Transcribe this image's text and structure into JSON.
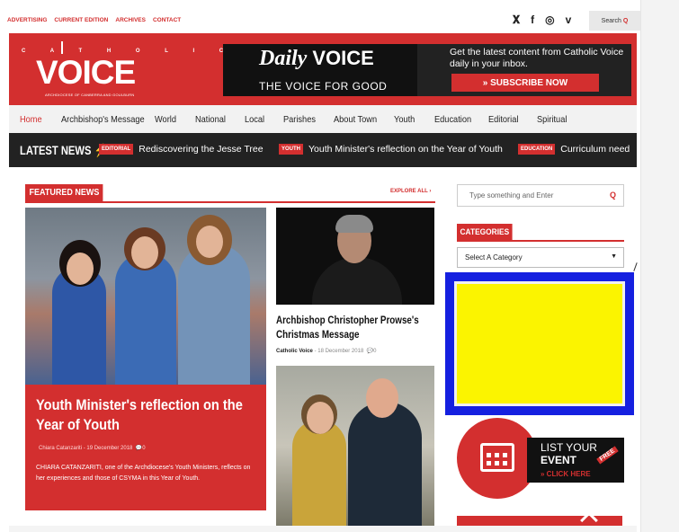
{
  "toplinks": [
    "ADVERTISING",
    "CURRENT EDITION",
    "ARCHIVES",
    "CONTACT"
  ],
  "social_icons": [
    "twitter-icon",
    "facebook-icon",
    "instagram-icon",
    "vimeo-icon"
  ],
  "top_search": {
    "label": "Search",
    "icon": "Q"
  },
  "logo": {
    "top_letters": "C A T H O L I C",
    "main": "VOICE",
    "sub": "ARCHDIOCESE OF CANBERRA AND GOULBURN"
  },
  "daily_banner": {
    "brand": "Daily",
    "brand2": "VOICE",
    "tagline": "THE VOICE FOR GOOD"
  },
  "promo": {
    "text": "Get the latest content from Catholic Voice daily in your inbox.",
    "button": "» SUBSCRIBE NOW"
  },
  "nav": [
    "Home",
    "Archbishop's Message",
    "World",
    "National",
    "Local",
    "Parishes",
    "About Town",
    "Youth",
    "Education",
    "Editorial",
    "Spiritual"
  ],
  "ticker": {
    "label": "LATEST NEWS",
    "items": [
      {
        "badge": "EDITORIAL",
        "text": "Rediscovering the Jesse Tree"
      },
      {
        "badge": "YOUTH",
        "text": "Youth Minister's reflection on the Year of Youth"
      },
      {
        "badge": "EDUCATION",
        "text": "Curriculum need"
      }
    ]
  },
  "featured": {
    "title": "FEATURED NEWS",
    "explore": "EXPLORE ALL",
    "main": {
      "headline": "Youth Minister's reflection on the Year of Youth",
      "meta": "Chiara Catanzariti - 19 December 2018",
      "comments": "0",
      "excerpt": "CHIARA CATANZARITI, one of the Archdiocese's Youth Ministers, reflects on her experiences and those of CSYMA in this Year of Youth."
    },
    "second": {
      "headline": "Archbishop Christopher Prowse's Christmas Message",
      "author": "Catholic Voice",
      "date": "18 December 2018",
      "comments": "0"
    }
  },
  "sidebar": {
    "search_placeholder": "Type something and Enter",
    "categories_title": "CATEGORIES",
    "categories_select": "Select A Category",
    "event": {
      "line1": "LIST YOUR",
      "line2": "EVENT",
      "line3": "» CLICK HERE",
      "free": "FREE"
    }
  }
}
